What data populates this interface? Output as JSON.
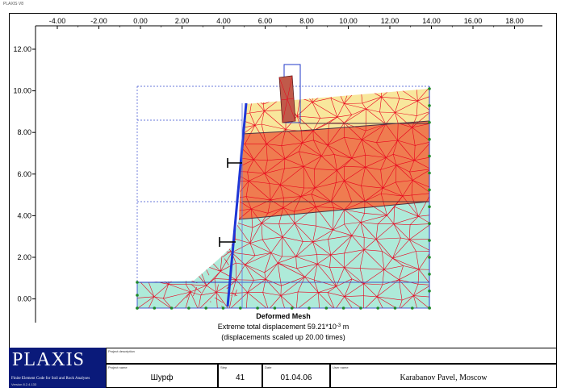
{
  "app": {
    "label": "PLAXIS V8"
  },
  "axes": {
    "x_ticks": [
      "-4.00",
      "-2.00",
      "0.00",
      "2.00",
      "4.00",
      "6.00",
      "8.00",
      "10.00",
      "12.00",
      "14.00",
      "16.00",
      "18.00"
    ],
    "y_ticks": [
      "12.00",
      "10.00",
      "8.00",
      "6.00",
      "4.00",
      "2.00",
      "0.00"
    ]
  },
  "plot": {
    "title": "Deformed Mesh",
    "displacement_label": "Extreme total displacement 59.21*10",
    "displacement_exponent": "-3",
    "displacement_unit": " m",
    "scale_note": "(displacements scaled up 20.00 times)"
  },
  "layers": [
    {
      "name": "top-fill",
      "color": "#f8e79c"
    },
    {
      "name": "middle-clay",
      "color": "#ef7c50"
    },
    {
      "name": "bottom-sand",
      "color": "#aeead9"
    }
  ],
  "colors": {
    "mesh": "#e8001c",
    "wall": "#1e36d6",
    "boundary": "#2038c8",
    "node": "#1f8a2a",
    "logo_bg": "#0a1a7a"
  },
  "titleblock": {
    "logo_text": "PLAXIS",
    "logo_sub": "Finite Element Code for Soil and Rock Analyses",
    "version": "Version 8.2.4.133",
    "project_description_label": "Project description",
    "project_name_label": "Project name",
    "project_name": "Шурф",
    "step_label": "Step",
    "step": "41",
    "date_label": "Date",
    "date": "01.04.06",
    "user_label": "User name",
    "user": "Karabanov Pavel, Moscow"
  }
}
